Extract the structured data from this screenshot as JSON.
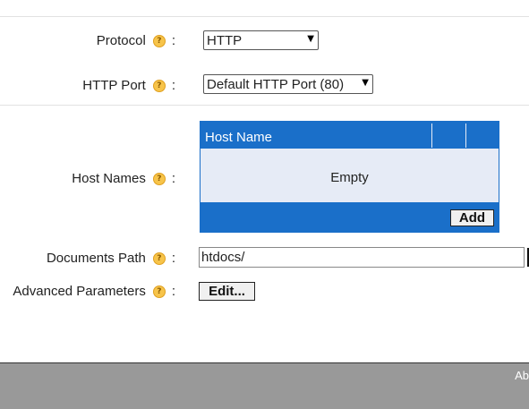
{
  "protocol": {
    "label": "Protocol",
    "help_icon": "help-icon",
    "colon": ":",
    "value": "HTTP"
  },
  "http_port": {
    "label": "HTTP Port",
    "help_icon": "help-icon",
    "colon": ":",
    "value": "Default HTTP Port (80)"
  },
  "host_names": {
    "label": "Host Names",
    "help_icon": "help-icon",
    "colon": ":",
    "column_header": "Host Name",
    "empty_text": "Empty",
    "add_label": "Add",
    "accent_color": "#1a6fc9"
  },
  "documents_path": {
    "label": "Documents Path",
    "help_icon": "help-icon",
    "colon": ":",
    "value": "htdocs/"
  },
  "advanced": {
    "label": "Advanced Parameters",
    "help_icon": "help-icon",
    "colon": ":",
    "edit_label": "Edit..."
  },
  "footer": {
    "text": "Ab"
  }
}
